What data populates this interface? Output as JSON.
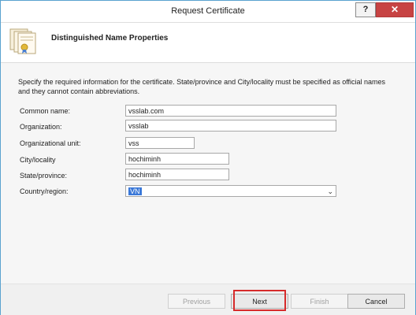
{
  "window": {
    "title": "Request Certificate",
    "help": "?",
    "close": "✕"
  },
  "header": {
    "title": "Distinguished Name Properties",
    "icon": "certificate-icon"
  },
  "description": "Specify the required information for the certificate. State/province and City/locality must be specified as official names and they cannot contain abbreviations.",
  "form": {
    "common_name": {
      "label": "Common name:",
      "value": "vsslab.com"
    },
    "organization": {
      "label": "Organization:",
      "value": "vsslab"
    },
    "org_unit": {
      "label": "Organizational unit:",
      "value": "vss"
    },
    "city": {
      "label": "City/locality",
      "value": "hochiminh"
    },
    "state": {
      "label": "State/province:",
      "value": "hochiminh"
    },
    "country": {
      "label": "Country/region:",
      "value": "VN"
    }
  },
  "buttons": {
    "previous": "Previous",
    "next": "Next",
    "finish": "Finish",
    "cancel": "Cancel"
  },
  "colors": {
    "highlight": "#d62b2b",
    "selection": "#3a78d8",
    "close": "#c74343"
  }
}
